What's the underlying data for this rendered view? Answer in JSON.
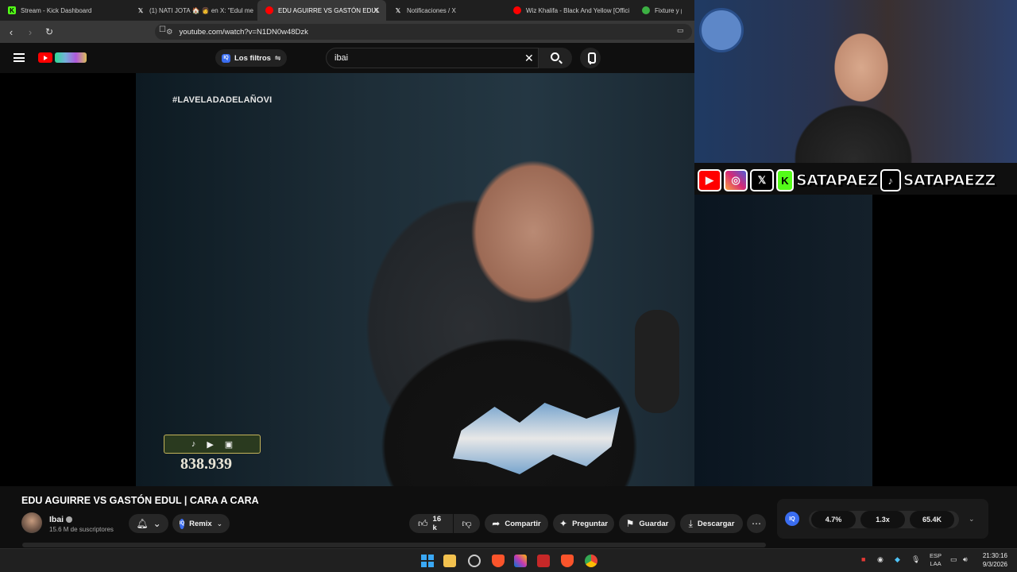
{
  "tabs": [
    {
      "title": "Stream - Kick Dashboard",
      "icon": "kick-icon",
      "active": false
    },
    {
      "title": "(1) NATI JOTA 🏠 👩 en X: \"Edul me",
      "icon": "x-icon",
      "active": false
    },
    {
      "title": "EDU AGUIRRE VS GASTÓN EDUL",
      "icon": "youtube-icon",
      "active": true
    },
    {
      "title": "Notificaciones / X",
      "icon": "x-icon",
      "active": false
    },
    {
      "title": "Wiz Khalifa - Black And Yellow [Offici",
      "icon": "youtube-icon",
      "active": false
    },
    {
      "title": "Fixture y p",
      "icon": "green-icon",
      "active": false
    }
  ],
  "address": {
    "url": "youtube.com/watch?v=N1DN0w48Dzk"
  },
  "header": {
    "filters_label": "Los filtros",
    "iq_badge": "IQ",
    "search_value": "ibai"
  },
  "video": {
    "hashtag": "#LAVELADADELAÑOVI",
    "viewers": "838.939"
  },
  "webcam": {
    "handle_kick": "SATAPAEZ",
    "handle_tiktok": "SATAPAEZZ"
  },
  "info": {
    "title": "EDU AGUIRRE VS GASTÓN EDUL | CARA A CARA",
    "channel": "Ibai",
    "subscribers": "15.6 M de suscriptores",
    "remix_label": "Remix",
    "likes": "16 k",
    "share_label": "Compartir",
    "ask_label": "Preguntar",
    "save_label": "Guardar",
    "download_label": "Descargar"
  },
  "iq_panel": {
    "logo": "IQ",
    "stat1": "4.7%",
    "stat2": "1.3x",
    "stat3": "65.4K"
  },
  "taskbar": {
    "lang_top": "ESP",
    "lang_bottom": "LAA",
    "time": "21:30:16",
    "date": "9/3/2026"
  },
  "colors": {
    "youtube_red": "#ff0000",
    "kick_green": "#53fc18",
    "iq_blue": "#3a6df0"
  }
}
